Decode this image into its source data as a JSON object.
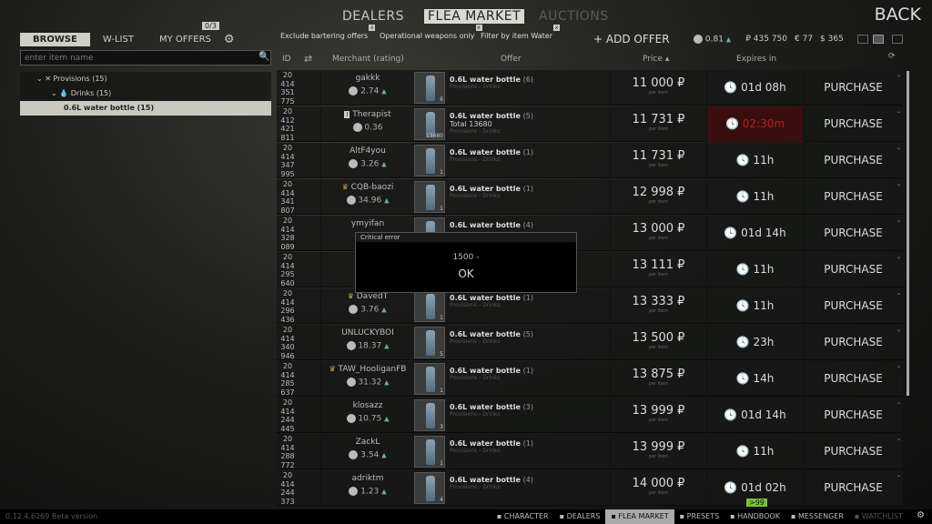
{
  "top_tabs": [
    {
      "label": "DEALERS"
    },
    {
      "label": "FLEA MARKET",
      "active": true
    },
    {
      "label": "AUCTIONS",
      "disabled": true
    }
  ],
  "back_label": "BACK",
  "side_tabs": [
    "BROWSE",
    "W-LIST",
    "MY OFFERS"
  ],
  "offers_count": "0/3",
  "search": {
    "placeholder": "enter item name"
  },
  "tree": [
    {
      "label": "Provisions (15)"
    },
    {
      "label": "Drinks (15)"
    },
    {
      "label": "0.6L water bottle (15)"
    }
  ],
  "filters": [
    "Exclude bartering offers",
    "Operational weapons only",
    "Filter by item Water"
  ],
  "add_offer": "+ ADD OFFER",
  "rating": "0.81",
  "money": {
    "rub": "₽ 435 750",
    "eur": "€ 77",
    "usd": "$ 365"
  },
  "headers": {
    "id": "ID",
    "merchant": "Merchant (rating)",
    "offer": "Offer",
    "price": "Price ▴",
    "expires": "Expires in"
  },
  "accent": "#7ac23a",
  "offers": [
    {
      "id": [
        "20",
        "414",
        "351",
        "775"
      ],
      "merchant": "gakkk",
      "rating": "2.74",
      "item": "0.6L water bottle",
      "qty": "(6)",
      "img_qty": "6",
      "category": "Provisions › Drinks",
      "price": "11 000 ₽",
      "per": "per item",
      "expires": "01d 08h",
      "buy": "PURCHASE"
    },
    {
      "id": [
        "20",
        "412",
        "421",
        "811"
      ],
      "merchant": "Therapist",
      "trader": true,
      "rating": "0.36",
      "item": "0.6L water bottle",
      "qty": "(5)",
      "total": "Total 13680",
      "img_qty": "13680",
      "category": "Provisions › Drinks",
      "price": "11 731 ₽",
      "per": "per item",
      "expires": "02:30m",
      "expiring": true,
      "buy": "PURCHASE"
    },
    {
      "id": [
        "20",
        "414",
        "347",
        "995"
      ],
      "merchant": "AltF4you",
      "rating": "3.26",
      "item": "0.6L water bottle",
      "qty": "(1)",
      "img_qty": "1",
      "category": "Provisions › Drinks",
      "price": "11 731 ₽",
      "per": "per item",
      "expires": "11h",
      "buy": "PURCHASE"
    },
    {
      "id": [
        "20",
        "414",
        "341",
        "807"
      ],
      "merchant": "CQB-baozi",
      "crown": true,
      "rating": "34.96",
      "item": "0.6L water bottle",
      "qty": "(1)",
      "img_qty": "1",
      "category": "Provisions › Drinks",
      "price": "12 998 ₽",
      "per": "per item",
      "expires": "11h",
      "buy": "PURCHASE"
    },
    {
      "id": [
        "20",
        "414",
        "328",
        "089"
      ],
      "merchant": "ymyifan",
      "rating": "",
      "item": "0.6L water bottle",
      "qty": "(4)",
      "img_qty": "",
      "category": "",
      "price": "13 000 ₽",
      "per": "per item",
      "expires": "01d 14h",
      "buy": "PURCHASE"
    },
    {
      "id": [
        "20",
        "414",
        "295",
        "640"
      ],
      "merchant": "",
      "crown": true,
      "rating": "",
      "item": "",
      "qty": "",
      "img_qty": "",
      "category": "",
      "price": "13 111 ₽",
      "per": "per item",
      "expires": "11h",
      "buy": "PURCHASE"
    },
    {
      "id": [
        "20",
        "414",
        "296",
        "436"
      ],
      "merchant": "DavedT",
      "crown": true,
      "rating": "3.76",
      "item": "0.6L water bottle",
      "qty": "(1)",
      "img_qty": "1",
      "category": "Provisions › Drinks",
      "price": "13 333 ₽",
      "per": "per item",
      "expires": "11h",
      "buy": "PURCHASE"
    },
    {
      "id": [
        "20",
        "414",
        "340",
        "946"
      ],
      "merchant": "UNLUCKYBOI",
      "rating": "18.37",
      "item": "0.6L water bottle",
      "qty": "(5)",
      "img_qty": "5",
      "category": "Provisions › Drinks",
      "price": "13 500 ₽",
      "per": "per item",
      "expires": "23h",
      "buy": "PURCHASE"
    },
    {
      "id": [
        "20",
        "414",
        "285",
        "637"
      ],
      "merchant": "TAW_HooliganFB",
      "crown": true,
      "rating": "31.32",
      "item": "0.6L water bottle",
      "qty": "(1)",
      "img_qty": "1",
      "category": "Provisions › Drinks",
      "price": "13 875 ₽",
      "per": "per item",
      "expires": "14h",
      "buy": "PURCHASE"
    },
    {
      "id": [
        "20",
        "414",
        "244",
        "445"
      ],
      "merchant": "klosazz",
      "rating": "10.75",
      "item": "0.6L water bottle",
      "qty": "(3)",
      "img_qty": "3",
      "category": "Provisions › Drinks",
      "price": "13 999 ₽",
      "per": "per item",
      "expires": "01d 14h",
      "buy": "PURCHASE"
    },
    {
      "id": [
        "20",
        "414",
        "288",
        "772"
      ],
      "merchant": "ZackL",
      "rating": "3.54",
      "item": "0.6L water bottle",
      "qty": "(1)",
      "img_qty": "1",
      "category": "Provisions › Drinks",
      "price": "13 999 ₽",
      "per": "per item",
      "expires": "11h",
      "buy": "PURCHASE"
    },
    {
      "id": [
        "20",
        "414",
        "244",
        "373"
      ],
      "merchant": "adriktm",
      "rating": "1.23",
      "item": "0.6L water bottle",
      "qty": "(4)",
      "img_qty": "4",
      "category": "Provisions › Drinks",
      "price": "14 000 ₽",
      "per": "per item",
      "expires": "01d 02h",
      "buy": "PURCHASE"
    }
  ],
  "dialog": {
    "title": "Critical error",
    "message": "1500 -",
    "ok": "OK"
  },
  "version": "0.12.4.6269 Beta version",
  "nav": [
    {
      "label": "CHARACTER"
    },
    {
      "label": "DEALERS"
    },
    {
      "label": "FLEA MARKET",
      "active": true
    },
    {
      "label": "PRESETS"
    },
    {
      "label": "HANDBOOK"
    },
    {
      "label": "MESSENGER"
    },
    {
      "label": "WATCHLIST",
      "disabled": true
    }
  ],
  "messenger_badge": ">99"
}
